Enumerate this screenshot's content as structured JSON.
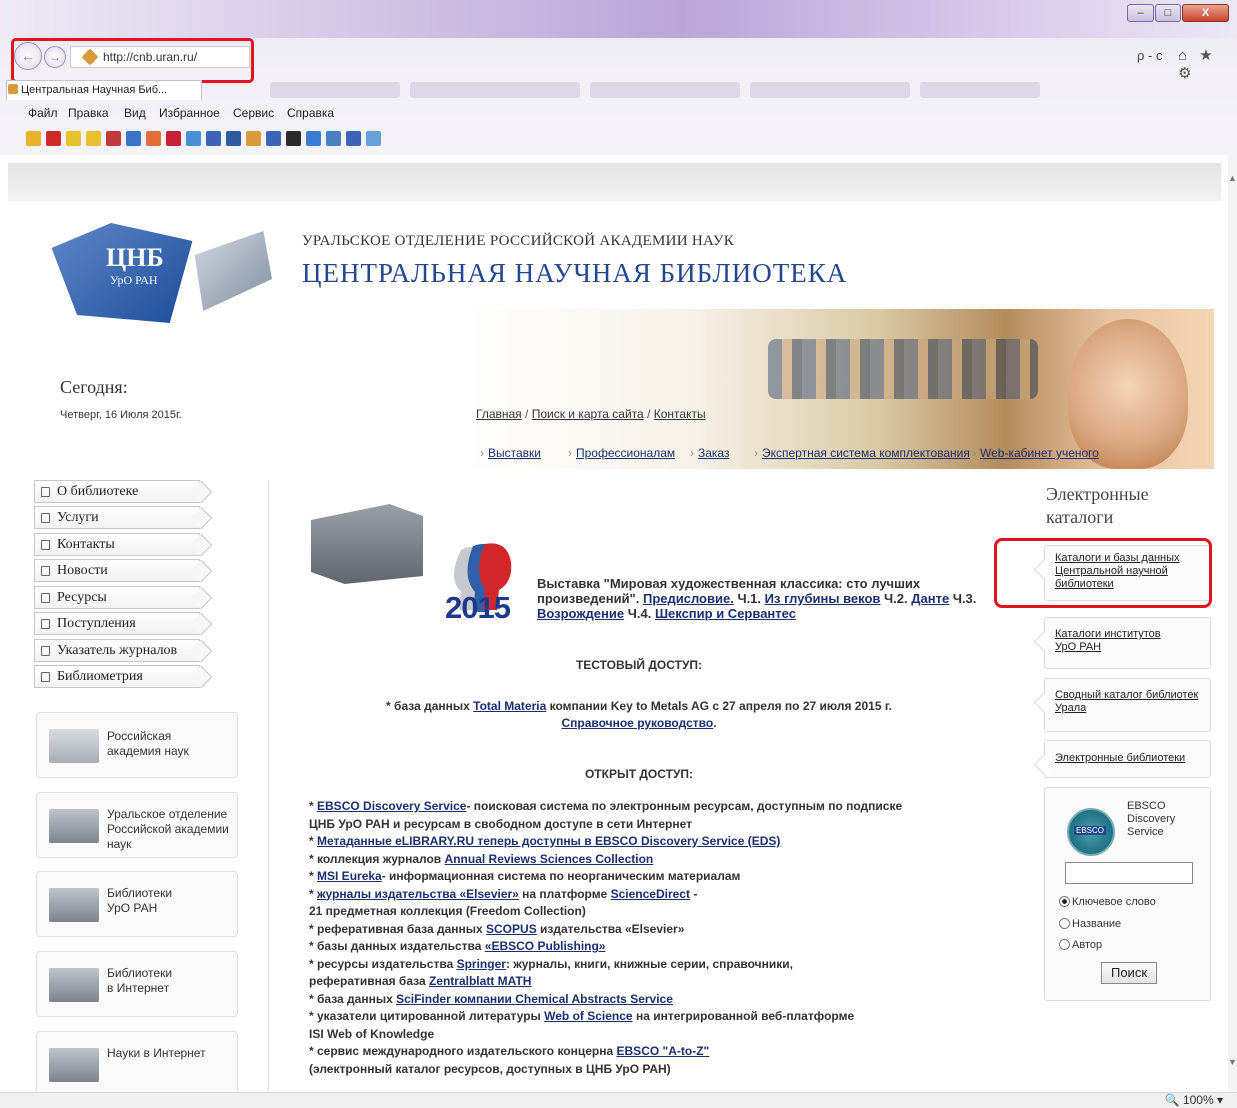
{
  "browser": {
    "url": "http://cnb.uran.ru/",
    "tab_title": "Центральная Научная Биб...",
    "menu": [
      "Файл",
      "Правка",
      "Вид",
      "Избранное",
      "Сервис",
      "Справка"
    ],
    "search_glyph": "ρ - c",
    "home_icons": "⌂ ★ ⚙",
    "win_buttons": {
      "minimize": "–",
      "maximize": "□",
      "close": "X"
    }
  },
  "status": {
    "zoom": "100%"
  },
  "header": {
    "subtitle": "УРАЛЬСКОЕ ОТДЕЛЕНИЕ РОССИЙСКОЙ АКАДЕМИИ НАУК",
    "title": "ЦЕНТРАЛЬНАЯ НАУЧНАЯ БИБЛИОТЕКА",
    "logo_text": "ЦНБ",
    "logo_sub": "УрО РАН"
  },
  "today": {
    "label": "Сегодня:",
    "date": "Четверг, 16 Июля 2015г."
  },
  "breadcrumbs": {
    "home": "Главная",
    "sep": "/",
    "search": "Поиск и карта сайта",
    "contacts": "Контакты"
  },
  "subnav": [
    "Выставки",
    "Профессионалам",
    "Заказ",
    "Экспертная система комплектования",
    "Web-кабинет ученого"
  ],
  "left_menu": [
    "О библиотеке",
    "Услуги",
    "Контакты",
    "Новости",
    "Ресурсы",
    "Поступления",
    "Указатель журналов",
    "Библиометрия"
  ],
  "left_boxes": [
    {
      "line1": "Российская",
      "line2": "академия наук",
      "line3": ""
    },
    {
      "line1": "Уральское отделение",
      "line2": "Российской академии",
      "line3": "наук"
    },
    {
      "line1": "Библиотеки",
      "line2": "УрО РАН",
      "line3": ""
    },
    {
      "line1": "Библиотеки",
      "line2": "в Интернет",
      "line3": ""
    },
    {
      "line1": "Науки в Интернет",
      "line2": "",
      "line3": ""
    }
  ],
  "center": {
    "year": "2015",
    "exhibition": {
      "prefix": "Выставка \"Мировая художественная классика: сто лучших произведений\".",
      "preface": "Предисловие.",
      "p1_label": "Ч.1.",
      "p1_link": "Из глубины веков",
      "p2_label": "Ч.2.",
      "p2_link": "Данте",
      "p3_label": "Ч.3.",
      "p3_link": "Возрождение",
      "p4_label": "Ч.4.",
      "p4_link": "Шекспир и Сервантес"
    },
    "test_heading": "ТЕСТОВЫЙ ДОСТУП:",
    "test_line_prefix": "* база данных",
    "test_link": "Total Materia",
    "test_line_suffix": "компании Key to Metals AG с 27 апреля по 27 июля 2015 г.",
    "test_guide": "Справочное руководство",
    "open_heading": "ОТКРЫТ ДОСТУП:",
    "items": [
      {
        "pre": "* ",
        "link": "EBSCO Discovery Service",
        "post": "- поисковая система по электронным ресурсам, доступным по подписке"
      },
      {
        "pre": "ЦНБ УрО РАН и ресурсам в свободном доступе в сети Интернет",
        "link": "",
        "post": ""
      },
      {
        "pre": "* ",
        "link": "Метаданные eLIBRARY.RU теперь доступны в EBSCO Discovery Service (EDS)",
        "post": ""
      },
      {
        "pre": "* коллекция журналов ",
        "link": "Annual Reviews Sciences Collection",
        "post": ""
      },
      {
        "pre": "* ",
        "link": "MSI Eureka",
        "post": "- информационная система по неорганическим материалам"
      },
      {
        "pre": "* ",
        "link": "журналы издательства «Elsevier»",
        "post": " на платформе ",
        "link2": "ScienceDirect",
        "post2": " -"
      },
      {
        "pre": "21 предметная коллекция (Freedom Collection)",
        "link": "",
        "post": ""
      },
      {
        "pre": "* реферативная база данных ",
        "link": "SCOPUS",
        "post": " издательства «Elsevier»"
      },
      {
        "pre": "* базы данных издательства ",
        "link": "«EBSCO Publishing»",
        "post": ""
      },
      {
        "pre": "* ресурсы издательства ",
        "link": "Springer",
        "post": ": журналы, книги, книжные серии, справочники,"
      },
      {
        "pre": "  реферативная база ",
        "link": "Zentralblatt MATH",
        "post": ""
      },
      {
        "pre": "* база данных ",
        "link": "SciFinder компании Chemical Abstracts Service",
        "post": ""
      },
      {
        "pre": "* указатели цитированной литературы ",
        "link": "Web of Science",
        "post": " на интегрированной веб-платформе"
      },
      {
        "pre": " ISI Web of Knowledge",
        "link": "",
        "post": ""
      },
      {
        "pre": "* сервис международного издательского концерна ",
        "link": "EBSCO \"A-to-Z\"",
        "post": ""
      },
      {
        "pre": " (электронный каталог ресурсов, доступных в ЦНБ УрО РАН)",
        "link": "",
        "post": ""
      }
    ]
  },
  "right": {
    "title_line1": "Электронные",
    "title_line2": "каталоги",
    "boxes": [
      {
        "line1": "Каталоги и базы данных",
        "line2": "Центральной научной",
        "line3": "библиотеки"
      },
      {
        "line1": "Каталоги институтов",
        "line2": "УрО РАН",
        "line3": ""
      },
      {
        "line1": "Сводный каталог библиотек",
        "line2": "Урала",
        "line3": ""
      },
      {
        "line1": "Электронные библиотеки",
        "line2": "",
        "line3": ""
      }
    ],
    "ebsco": {
      "logo_text": "EBSCO",
      "name_line1": "EBSCO",
      "name_line2": "Discovery",
      "name_line3": "Service",
      "search_value": "",
      "radios": [
        "Ключевое слово",
        "Название",
        "Автор"
      ],
      "selected_radio": "Ключевое слово",
      "button": "Поиск"
    }
  }
}
